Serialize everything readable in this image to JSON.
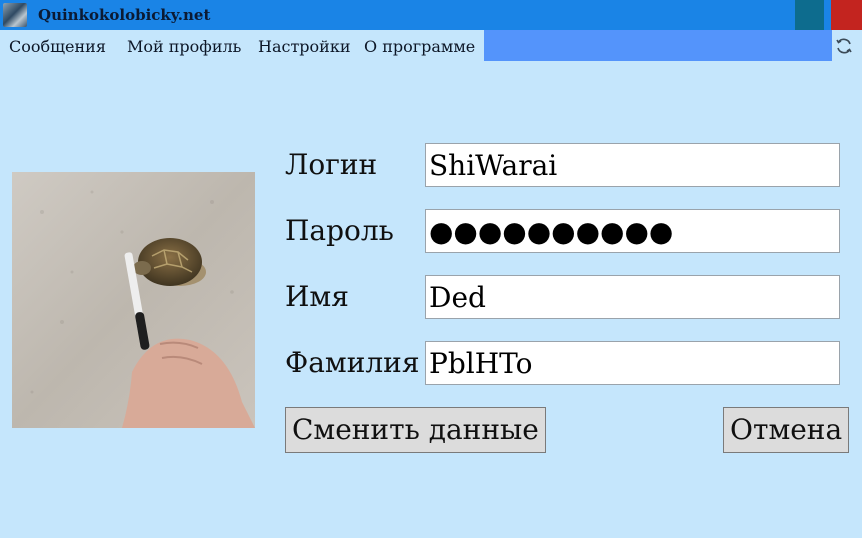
{
  "window": {
    "title": "Quinkokolobicky.net",
    "icon": "app-icon",
    "colors": {
      "titlebar": "#1a84e6",
      "minimize": "#0d6c8e",
      "close": "#c3241f"
    }
  },
  "menu": {
    "items": [
      {
        "label": "Сообщения"
      },
      {
        "label": "Мой профиль"
      },
      {
        "label": "Настройки"
      },
      {
        "label": "О программе"
      }
    ],
    "refresh_icon": "refresh-icon",
    "highlight_color": "#5494fb"
  },
  "profile": {
    "avatar_icon": "avatar-image",
    "fields": {
      "login": {
        "label": "Логин",
        "value": "ShiWarai"
      },
      "password": {
        "label": "Пароль",
        "value": "●●●●●●●●●●"
      },
      "name": {
        "label": "Имя",
        "value": "Ded"
      },
      "surname": {
        "label": "Фамилия",
        "value": "PblHTo"
      }
    },
    "buttons": {
      "save": "Сменить данные",
      "cancel": "Отмена"
    }
  },
  "colors": {
    "background": "#c5e6fc",
    "button": "#dcdcdc"
  }
}
